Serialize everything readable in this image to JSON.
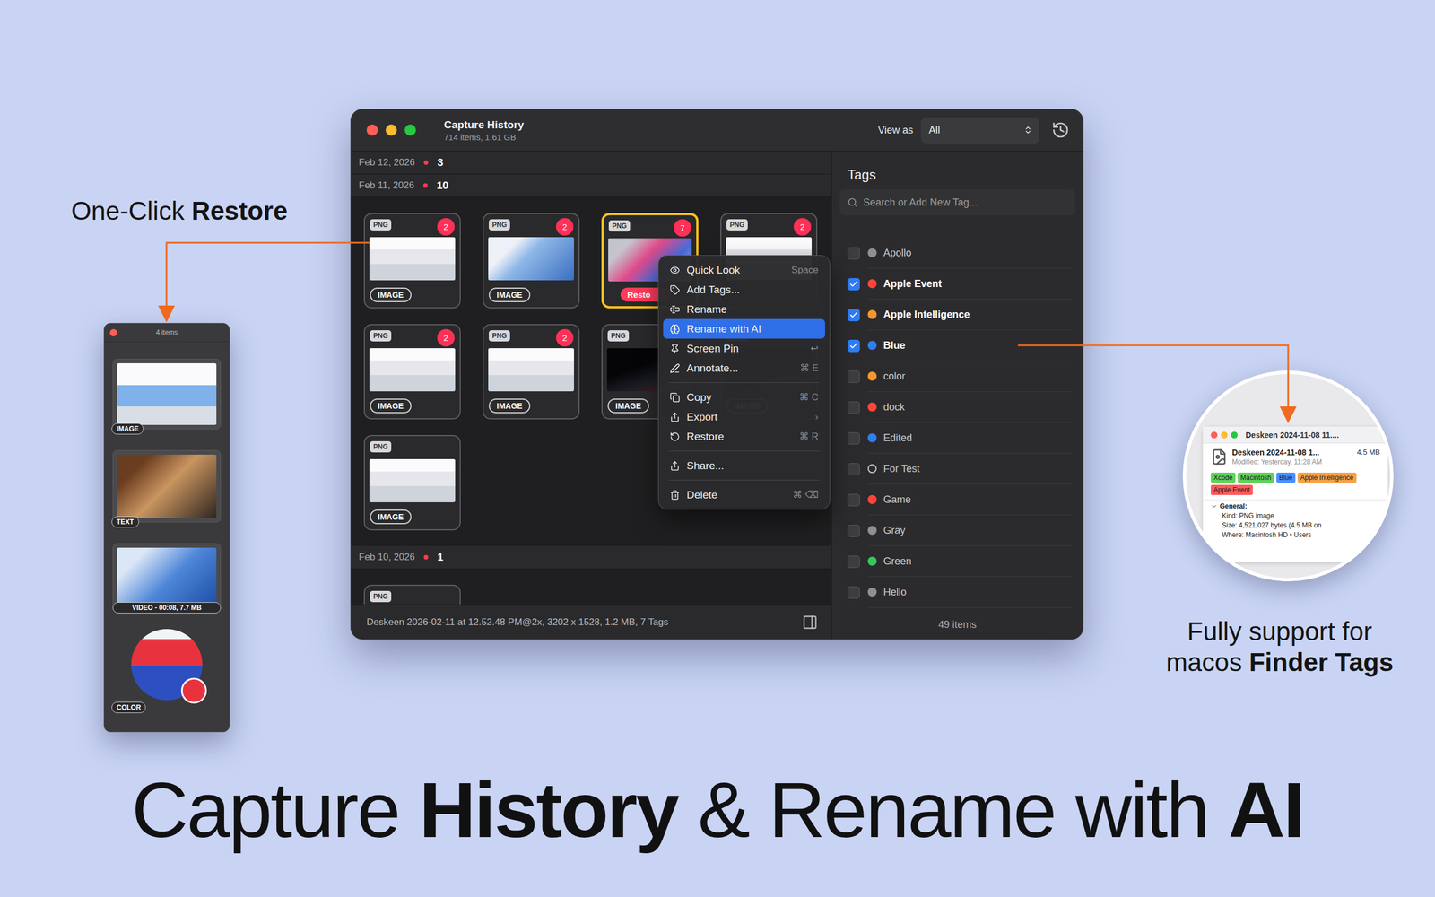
{
  "callouts": {
    "restore": [
      {
        "text": "One-Click ",
        "bold": false
      },
      {
        "text": "Restore",
        "bold": true
      }
    ],
    "finder": [
      [
        {
          "text": "Fully support for",
          "bold": false
        }
      ],
      [
        {
          "text": "macos ",
          "bold": false
        },
        {
          "text": "Finder Tags",
          "bold": true
        }
      ]
    ],
    "headline": [
      {
        "text": "Capture ",
        "bold": false
      },
      {
        "text": "History",
        "bold": true
      },
      {
        "text": " & Rename with ",
        "bold": false
      },
      {
        "text": "AI",
        "bold": true
      }
    ]
  },
  "window": {
    "title": "Capture History",
    "subtitle": "714 items, 1.61 GB",
    "view_as_label": "View as",
    "view_as_value": "All"
  },
  "sections": [
    {
      "date": "Feb 12, 2026",
      "count": "3",
      "thumbnails": []
    },
    {
      "date": "Feb 11, 2026",
      "count": "10",
      "thumbnails": [
        {
          "type": "PNG",
          "badge": "2",
          "label": "IMAGE",
          "restore": "",
          "selected": false,
          "kind": "light"
        },
        {
          "type": "PNG",
          "badge": "2",
          "label": "IMAGE",
          "restore": "",
          "selected": false,
          "kind": "wallpaper"
        },
        {
          "type": "PNG",
          "badge": "7",
          "label": "",
          "restore": "Resto",
          "selected": true,
          "kind": "colorful"
        },
        {
          "type": "PNG",
          "badge": "2",
          "label": "",
          "restore": "",
          "selected": false,
          "kind": "light"
        },
        {
          "type": "PNG",
          "badge": "2",
          "label": "IMAGE",
          "restore": "",
          "selected": false,
          "kind": "light"
        },
        {
          "type": "PNG",
          "badge": "2",
          "label": "IMAGE",
          "restore": "",
          "selected": false,
          "kind": "light"
        },
        {
          "type": "PNG",
          "badge": "",
          "label": "IMAGE",
          "restore": "",
          "selected": false,
          "kind": "dark"
        },
        {
          "type": "PNG",
          "badge": "",
          "label": "IMAGE",
          "restore": "",
          "selected": false,
          "kind": "dark"
        },
        {
          "type": "PNG",
          "badge": "",
          "label": "IMAGE",
          "restore": "",
          "selected": false,
          "kind": "light"
        }
      ]
    },
    {
      "date": "Feb 10, 2026",
      "count": "1",
      "thumbnails": [
        {
          "type": "PNG",
          "badge": "",
          "label": "",
          "restore": "",
          "selected": false,
          "kind": "light"
        }
      ]
    }
  ],
  "context_menu": {
    "groups": [
      [
        {
          "label": "Quick Look",
          "shortcut": "Space",
          "selected": false
        },
        {
          "label": "Add Tags...",
          "shortcut": "",
          "selected": false
        },
        {
          "label": "Rename",
          "shortcut": "",
          "selected": false
        },
        {
          "label": "Rename with AI",
          "shortcut": "",
          "selected": true
        },
        {
          "label": "Screen Pin",
          "shortcut": "↩",
          "selected": false
        },
        {
          "label": "Annotate...",
          "shortcut": "⌘ E",
          "selected": false
        }
      ],
      [
        {
          "label": "Copy",
          "shortcut": "⌘ C",
          "selected": false
        },
        {
          "label": "Export",
          "shortcut": "›",
          "selected": false
        },
        {
          "label": "Restore",
          "shortcut": "⌘ R",
          "selected": false
        }
      ],
      [
        {
          "label": "Share...",
          "shortcut": "",
          "selected": false
        }
      ],
      [
        {
          "label": "Delete",
          "shortcut": "⌘ ⌫",
          "selected": false
        }
      ]
    ]
  },
  "status_bar": {
    "text": "Deskeen 2026-02-11 at 12.52.48 PM@2x, 3202 x 1528, 1.2 MB, 7 Tags"
  },
  "tags_panel": {
    "title": "Tags",
    "search_placeholder": "Search or Add New Tag...",
    "footer": "49 items",
    "tags": [
      {
        "label": "Apollo",
        "checked": false,
        "kind": "dot",
        "color": "#8e8e93"
      },
      {
        "label": "Apple Event",
        "checked": true,
        "kind": "dot",
        "color": "#ff453a"
      },
      {
        "label": "Apple Intelligence",
        "checked": true,
        "kind": "dot",
        "color": "#f5962f"
      },
      {
        "label": "Blue",
        "checked": true,
        "kind": "dot",
        "color": "#2f7ff0"
      },
      {
        "label": "color",
        "checked": false,
        "kind": "dot",
        "color": "#f5962f"
      },
      {
        "label": "dock",
        "checked": false,
        "kind": "dot",
        "color": "#ff453a"
      },
      {
        "label": "Edited",
        "checked": false,
        "kind": "dot",
        "color": "#2f7ff0"
      },
      {
        "label": "For Test",
        "checked": false,
        "kind": "ring",
        "color": "#c8c8cc"
      },
      {
        "label": "Game",
        "checked": false,
        "kind": "dot",
        "color": "#ff453a"
      },
      {
        "label": "Gray",
        "checked": false,
        "kind": "dot",
        "color": "#8e8e93"
      },
      {
        "label": "Green",
        "checked": false,
        "kind": "dot",
        "color": "#34c759"
      },
      {
        "label": "Hello",
        "checked": false,
        "kind": "dot",
        "color": "#8e8e93"
      }
    ]
  },
  "mini_window": {
    "title": "4 items",
    "items": [
      {
        "label": "IMAGE",
        "kind": "image"
      },
      {
        "label": "TEXT",
        "kind": "text"
      },
      {
        "label": "VIDEO - 00:08, 7.7 MB",
        "kind": "video"
      },
      {
        "label": "COLOR",
        "kind": "color"
      }
    ]
  },
  "finder_info": {
    "title": "Deskeen 2024-11-08 11....",
    "file_name": "Deskeen 2024-11-08 1...",
    "size": "4.5 MB",
    "modified": "Modified: Yesterday, 11:28 AM",
    "tags": [
      {
        "label": "Xcode",
        "color": "#5fd35a"
      },
      {
        "label": "Macintosh",
        "color": "#5fd35a"
      },
      {
        "label": "Blue",
        "color": "#4a90ff"
      },
      {
        "label": "Apple Intelligence",
        "color": "#f7a24a"
      },
      {
        "label": "Apple Event",
        "color": "#ff5a5a"
      }
    ],
    "section": "General:",
    "details": [
      "Kind: PNG image",
      "Size: 4,521,027 bytes (4.5 MB on",
      "Where: Macintosh HD • Users"
    ]
  }
}
